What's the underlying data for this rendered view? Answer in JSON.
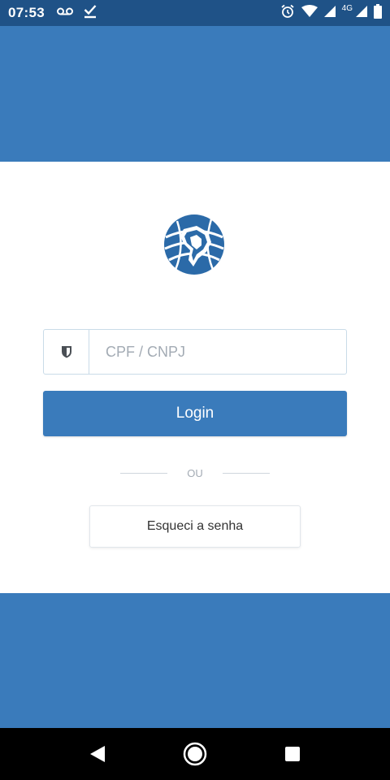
{
  "status_bar": {
    "time": "07:53",
    "network_label": "4G",
    "icons": [
      "voicemail-icon",
      "download-done-icon",
      "alarm-icon",
      "wifi-icon",
      "signal-icon",
      "signal-icon",
      "battery-icon"
    ]
  },
  "login": {
    "cpf_placeholder": "CPF / CNPJ",
    "login_label": "Login",
    "divider_text": "OU",
    "forgot_label": "Esqueci a senha"
  },
  "nav": {
    "icons": [
      "back-icon",
      "home-icon",
      "recents-icon"
    ]
  },
  "colors": {
    "brand_blue": "#3a7bbb",
    "status_bar": "#1f5287",
    "nav_bar": "#000000"
  }
}
